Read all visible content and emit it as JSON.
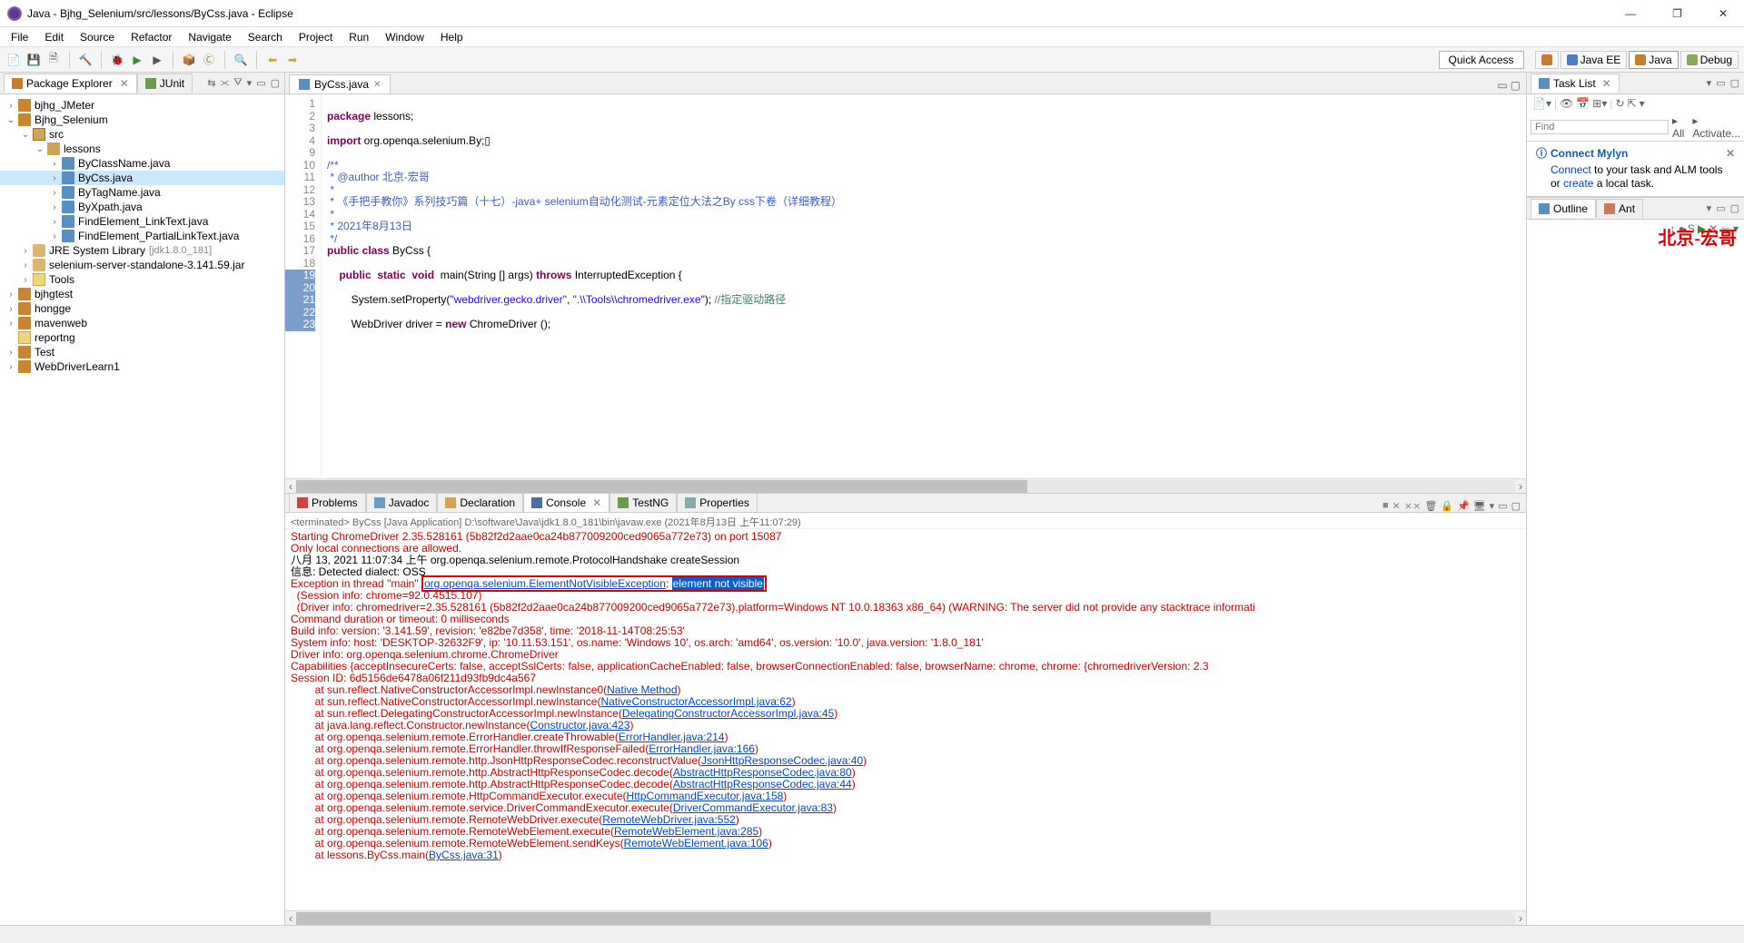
{
  "window": {
    "title": "Java - Bjhg_Selenium/src/lessons/ByCss.java - Eclipse"
  },
  "menu": {
    "items": [
      "File",
      "Edit",
      "Source",
      "Refactor",
      "Navigate",
      "Search",
      "Project",
      "Run",
      "Window",
      "Help"
    ]
  },
  "toolbar": {
    "quickaccess": "Quick Access"
  },
  "perspectives": {
    "items": [
      "",
      "Java EE",
      "Java",
      "Debug"
    ]
  },
  "views": {
    "package_explorer": "Package Explorer",
    "junit": "JUnit",
    "tasklist": "Task List",
    "outline": "Outline",
    "ant": "Ant"
  },
  "find": {
    "placeholder": "Find",
    "all": "All",
    "activate": "Activate..."
  },
  "mylyn": {
    "title": "Connect Mylyn",
    "connect": "Connect",
    "text1": " to your task and ALM tools or ",
    "create": "create",
    "text2": " a local task."
  },
  "tree": {
    "bjhg_jmeter": "bjhg_JMeter",
    "bjhg_selenium": "Bjhg_Selenium",
    "src": "src",
    "lessons": "lessons",
    "byclassname": "ByClassName.java",
    "bycss": "ByCss.java",
    "bytagname": "ByTagName.java",
    "byxpath": "ByXpath.java",
    "findlink": "FindElement_LinkText.java",
    "findpartial": "FindElement_PartialLinkText.java",
    "jre": "JRE System Library",
    "jre_ver": "[jdk1.8.0_181]",
    "seleniumjar": "selenium-server-standalone-3.141.59.jar",
    "tools": "Tools",
    "bjhgtest": "bjhgtest",
    "hongge": "hongge",
    "mavenweb": "mavenweb",
    "reportng": "reportng",
    "test": "Test",
    "webdriver": "WebDriverLearn1"
  },
  "editor": {
    "tab": "ByCss.java",
    "lines": {
      "l2": "package lessons;",
      "l4": "import org.openqa.selenium.By;",
      "l10": "/**",
      "l11": " * @author 北京-宏哥",
      "l12": " *",
      "l13": " * 《手把手教你》系列技巧篇（十七）-java+ selenium自动化测试-元素定位大法之By css下卷（详细教程）",
      "l14": " *",
      "l15": " * 2021年8月13日",
      "l16": " */",
      "l17a": "public class ByCss {",
      "l19": "    public  static  void  main(String [] args) throws InterruptedException {",
      "l21a": "        System.setProperty(",
      "l21b": "\"webdriver.gecko.driver\"",
      "l21c": ", ",
      "l21d": "\".\\\\Tools\\\\chromedriver.exe\"",
      "l21e": "); ",
      "l21f": "//指定驱动路径",
      "l23": "        WebDriver driver = new ChromeDriver ();"
    }
  },
  "bottom_tabs": {
    "problems": "Problems",
    "javadoc": "Javadoc",
    "declaration": "Declaration",
    "console": "Console",
    "testng": "TestNG",
    "properties": "Properties"
  },
  "console_header": "<terminated> ByCss [Java Application] D:\\software\\Java\\jdk1.8.0_181\\bin\\javaw.exe (2021年8月13日 上午11:07:29)",
  "console": {
    "l1": "Starting ChromeDriver 2.35.528161 (5b82f2d2aae0ca24b877009200ced9065a772e73) on port 15087",
    "l2": "Only local connections are allowed.",
    "l3a": "八月 13, 2021 11:07:34 上午 org.openqa.selenium.remote.ProtocolHandshake createSession",
    "l4": "信息: Detected dialect: OSS",
    "l5a": "Exception in thread \"main\" ",
    "l5b": "org.openqa.selenium.ElementNotVisibleException",
    "l5c": ": ",
    "l5d": "element not visible",
    "l6": "  (Session info: chrome=92.0.4515.107)",
    "l7": "  (Driver info: chromedriver=2.35.528161 (5b82f2d2aae0ca24b877009200ced9065a772e73),platform=Windows NT 10.0.18363 x86_64) (WARNING: The server did not provide any stacktrace informati",
    "l8": "Command duration or timeout: 0 milliseconds",
    "l9": "Build info: version: '3.141.59', revision: 'e82be7d358', time: '2018-11-14T08:25:53'",
    "l10": "System info: host: 'DESKTOP-32632F9', ip: '10.11.53.151', os.name: 'Windows 10', os.arch: 'amd64', os.version: '10.0', java.version: '1.8.0_181'",
    "l11": "Driver info: org.openqa.selenium.chrome.ChromeDriver",
    "l12": "Capabilities {acceptInsecureCerts: false, acceptSslCerts: false, applicationCacheEnabled: false, browserConnectionEnabled: false, browserName: chrome, chrome: {chromedriverVersion: 2.3",
    "l13": "Session ID: 6d5156de6478a06f211d93fb9dc4a567",
    "s1a": "\tat sun.reflect.NativeConstructorAccessorImpl.newInstance0(",
    "s1b": "Native Method",
    "s1c": ")",
    "s2a": "\tat sun.reflect.NativeConstructorAccessorImpl.newInstance(",
    "s2b": "NativeConstructorAccessorImpl.java:62",
    "s2c": ")",
    "s3a": "\tat sun.reflect.DelegatingConstructorAccessorImpl.newInstance(",
    "s3b": "DelegatingConstructorAccessorImpl.java:45",
    "s3c": ")",
    "s4a": "\tat java.lang.reflect.Constructor.newInstance(",
    "s4b": "Constructor.java:423",
    "s4c": ")",
    "s5a": "\tat org.openqa.selenium.remote.ErrorHandler.createThrowable(",
    "s5b": "ErrorHandler.java:214",
    "s5c": ")",
    "s6a": "\tat org.openqa.selenium.remote.ErrorHandler.throwIfResponseFailed(",
    "s6b": "ErrorHandler.java:166",
    "s6c": ")",
    "s7a": "\tat org.openqa.selenium.remote.http.JsonHttpResponseCodec.reconstructValue(",
    "s7b": "JsonHttpResponseCodec.java:40",
    "s7c": ")",
    "s8a": "\tat org.openqa.selenium.remote.http.AbstractHttpResponseCodec.decode(",
    "s8b": "AbstractHttpResponseCodec.java:80",
    "s8c": ")",
    "s9a": "\tat org.openqa.selenium.remote.http.AbstractHttpResponseCodec.decode(",
    "s9b": "AbstractHttpResponseCodec.java:44",
    "s9c": ")",
    "s10a": "\tat org.openqa.selenium.remote.HttpCommandExecutor.execute(",
    "s10b": "HttpCommandExecutor.java:158",
    "s10c": ")",
    "s11a": "\tat org.openqa.selenium.remote.service.DriverCommandExecutor.execute(",
    "s11b": "DriverCommandExecutor.java:83",
    "s11c": ")",
    "s12a": "\tat org.openqa.selenium.remote.RemoteWebDriver.execute(",
    "s12b": "RemoteWebDriver.java:552",
    "s12c": ")",
    "s13a": "\tat org.openqa.selenium.remote.RemoteWebElement.execute(",
    "s13b": "RemoteWebElement.java:285",
    "s13c": ")",
    "s14a": "\tat org.openqa.selenium.remote.RemoteWebElement.sendKeys(",
    "s14b": "RemoteWebElement.java:106",
    "s14c": ")",
    "s15a": "\tat lessons.ByCss.main(",
    "s15b": "ByCss.java:31",
    "s15c": ")"
  },
  "watermark": "北京-宏哥"
}
